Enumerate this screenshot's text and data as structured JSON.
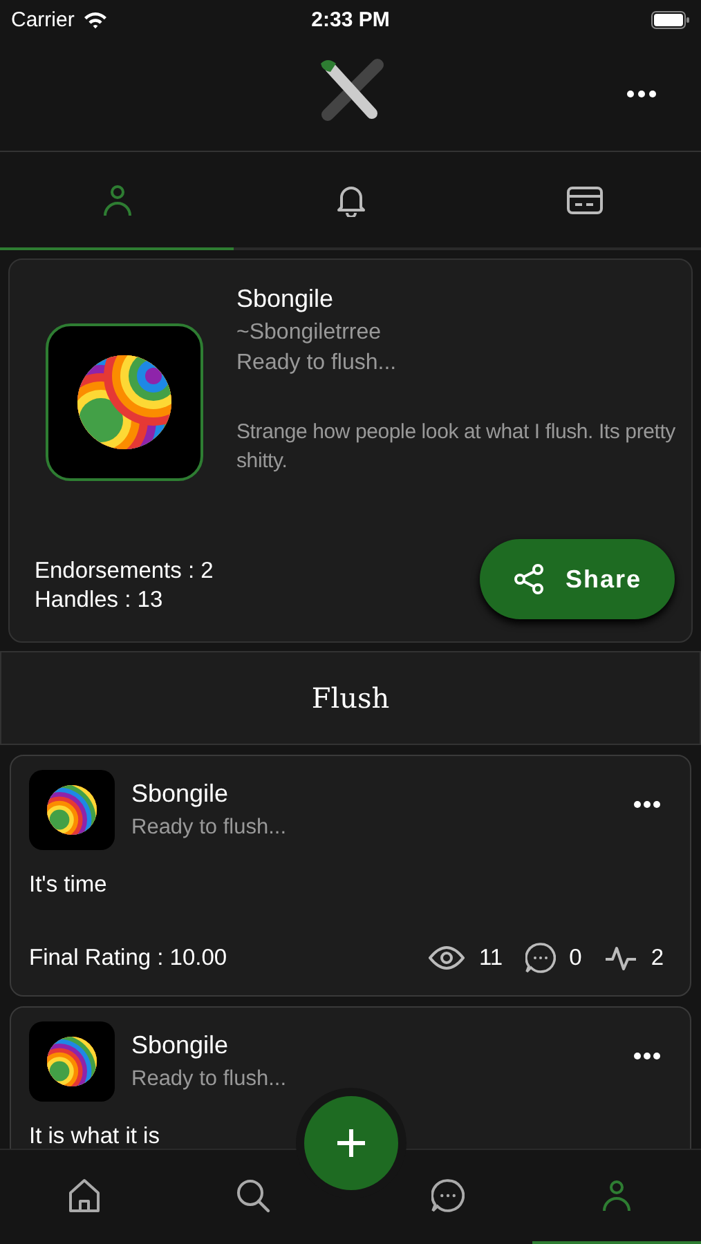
{
  "status_bar": {
    "carrier": "Carrier",
    "time": "2:33 PM"
  },
  "tabs": [
    {
      "kind": "person",
      "selected": true
    },
    {
      "kind": "bell",
      "selected": false
    },
    {
      "kind": "card",
      "selected": false
    }
  ],
  "profile": {
    "name": "Sbongile",
    "handle": "~Sbongiletrree",
    "status": "Ready to flush...",
    "bio": "Strange how people look at what I flush. Its pretty shitty.",
    "endorsements": "Endorsements : 2",
    "handles": "Handles : 13",
    "share_button": "Share"
  },
  "section_title": "Flush",
  "posts": [
    {
      "name": "Sbongile",
      "status": "Ready to flush...",
      "body": "It's time",
      "rating": "Final Rating : 10.00",
      "views": "11",
      "comments": "0",
      "activity": "2"
    },
    {
      "name": "Sbongile",
      "status": "Ready to flush...",
      "body": "It is what it is"
    }
  ],
  "bottom_nav": [
    {
      "kind": "home",
      "selected": false
    },
    {
      "kind": "search",
      "selected": false
    },
    {
      "kind": "chat",
      "selected": false
    },
    {
      "kind": "person",
      "selected": true
    }
  ]
}
